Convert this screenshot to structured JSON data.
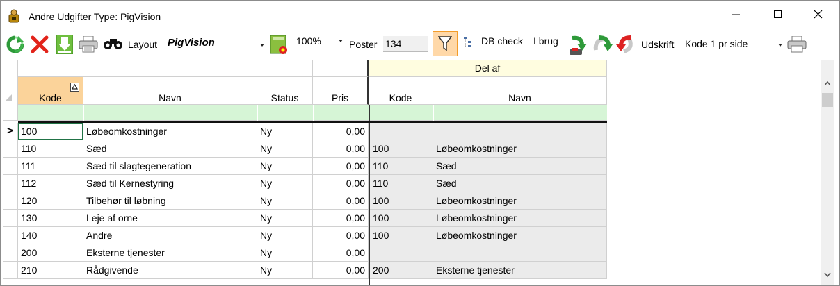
{
  "window": {
    "title": "Andre Udgifter Type: PigVision",
    "icon": "pig-app-icon",
    "controls": [
      "minimize-icon",
      "maximize-icon",
      "close-icon"
    ]
  },
  "toolbar": {
    "layout_label": "Layout",
    "layout_value": "PigVision",
    "zoom_value": "100%",
    "poster_label": "Poster",
    "poster_value": "134",
    "db_check_label": "DB check",
    "i_brug_label": "I brug",
    "udskrift_label": "Udskrift",
    "udskrift_value": "Kode 1 pr side",
    "icons": [
      "refresh-icon",
      "delete-icon",
      "save-down-icon",
      "print-icon",
      "binoculars-icon",
      "layout-edit-icon",
      "filter-icon",
      "tree-icon",
      "move-down-icon",
      "move-green-icon",
      "move-red-icon",
      "print-right-icon"
    ]
  },
  "grid": {
    "group_header": "Del af",
    "columns": [
      "Kode",
      "Navn",
      "Status",
      "Pris",
      "Kode",
      "Navn"
    ],
    "current_row_marker": ">",
    "rows": [
      {
        "kode": "100",
        "navn": "Løbeomkostninger",
        "status": "Ny",
        "pris": "0,00",
        "del_kode": "",
        "del_navn": ""
      },
      {
        "kode": "110",
        "navn": "Sæd",
        "status": "Ny",
        "pris": "0,00",
        "del_kode": "100",
        "del_navn": "Løbeomkostninger"
      },
      {
        "kode": "111",
        "navn": "Sæd til slagtegeneration",
        "status": "Ny",
        "pris": "0,00",
        "del_kode": "110",
        "del_navn": "Sæd"
      },
      {
        "kode": "112",
        "navn": "Sæd til Kernestyring",
        "status": "Ny",
        "pris": "0,00",
        "del_kode": "110",
        "del_navn": "Sæd"
      },
      {
        "kode": "120",
        "navn": "Tilbehør til løbning",
        "status": "Ny",
        "pris": "0,00",
        "del_kode": "100",
        "del_navn": "Løbeomkostninger"
      },
      {
        "kode": "130",
        "navn": "Leje af orne",
        "status": "Ny",
        "pris": "0,00",
        "del_kode": "100",
        "del_navn": "Løbeomkostninger"
      },
      {
        "kode": "140",
        "navn": "Andre",
        "status": "Ny",
        "pris": "0,00",
        "del_kode": "100",
        "del_navn": "Løbeomkostninger"
      },
      {
        "kode": "200",
        "navn": "Eksterne tjenester",
        "status": "Ny",
        "pris": "0,00",
        "del_kode": "",
        "del_navn": ""
      },
      {
        "kode": "210",
        "navn": "Rådgivende",
        "status": "Ny",
        "pris": "0,00",
        "del_kode": "200",
        "del_navn": "Eksterne tjenester"
      }
    ]
  },
  "colors": {
    "sorted_header": "#fbd39a",
    "filter_row": "#d6f5d6",
    "group_header": "#fffde0",
    "selected_cell_border": "#217346",
    "readonly_cell": "#ebebeb"
  }
}
